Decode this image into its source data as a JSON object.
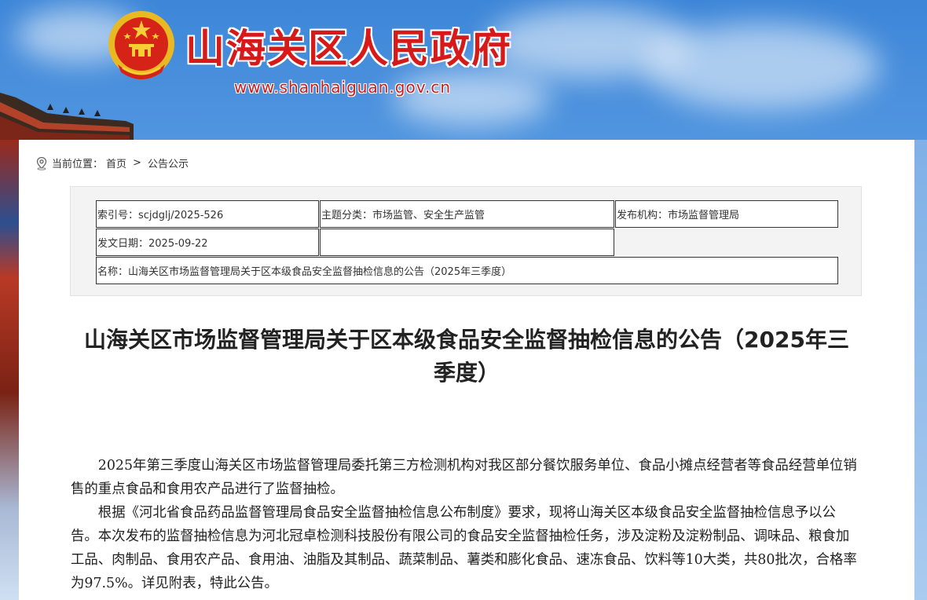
{
  "site": {
    "title": "山海关区人民政府",
    "url": "www.shanhaiguan.gov.cn"
  },
  "breadcrumb": {
    "prefix": "当前位置：",
    "home": "首页",
    "separator": ">",
    "current": "公告公示"
  },
  "meta": {
    "index_no": "索引号：scjdglj/2025-526",
    "topic": "主题分类：市场监管、安全生产监管",
    "publisher": "发布机构：市场监督管理局",
    "date": "发文日期：2025-09-22",
    "empty": "",
    "name": "名称：山海关区市场监督管理局关于区本级食品安全监督抽检信息的公告（2025年三季度）"
  },
  "article": {
    "title": "山海关区市场监督管理局关于区本级食品安全监督抽检信息的公告（2025年三季度）",
    "paragraphs": [
      "2025年第三季度山海关区市场监督管理局委托第三方检测机构对我区部分餐饮服务单位、食品小摊点经营者等食品经营单位销售的重点食品和食用农产品进行了监督抽检。",
      "根据《河北省食品药品监督管理局食品安全监督抽检信息公布制度》要求，现将山海关区本级食品安全监督抽检信息予以公告。本次发布的监督抽检信息为河北冠卓检测科技股份有限公司的食品安全监督抽检任务，涉及淀粉及淀粉制品、调味品、粮食加工品、肉制品、食用农产品、食用油、油脂及其制品、蔬菜制品、薯类和膨化食品、速冻食品、饮料等10大类，共80批次，合格率为97.5%。详见附表，特此公告。"
    ]
  },
  "colors": {
    "brand_red": "#d61a1a",
    "sky_blue": "#5b9de3"
  },
  "icons": {
    "emblem": "national-emblem-icon",
    "location": "location-pin-icon"
  }
}
